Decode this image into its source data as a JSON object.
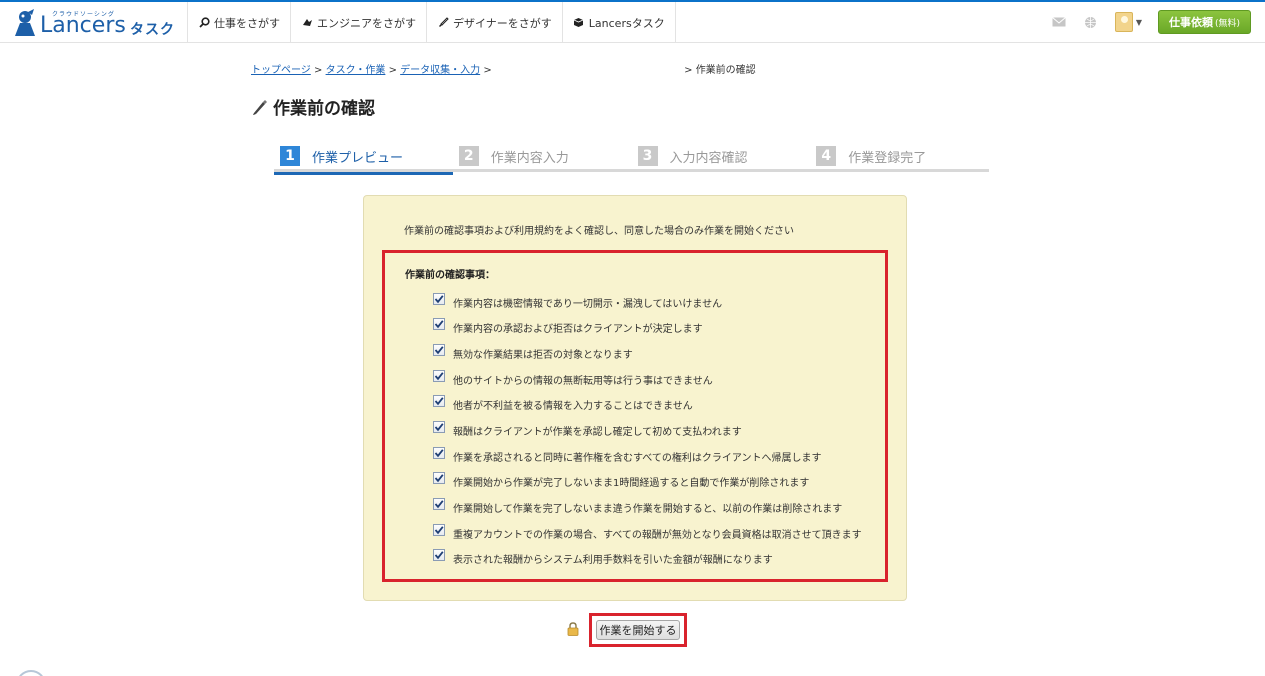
{
  "header": {
    "logo_tagline": "クラウドソーシング",
    "logo_word": "Lancers",
    "logo_suffix": "タスク",
    "nav": [
      {
        "label": "仕事をさがす",
        "icon": "search-icon"
      },
      {
        "label": "エンジニアをさがす",
        "icon": "engineer-icon"
      },
      {
        "label": "デザイナーをさがす",
        "icon": "brush-icon"
      },
      {
        "label": "Lancersタスク",
        "icon": "tasks-icon"
      }
    ],
    "order_button": "仕事依頼",
    "order_button_note": "(無料)"
  },
  "breadcrumb": {
    "items": [
      "トップページ",
      "タスク・作業",
      "データ収集・入力"
    ],
    "current": "作業前の確認",
    "separator": ">"
  },
  "page_title": "作業前の確認",
  "steps": [
    {
      "num": "1",
      "label": "作業プレビュー",
      "active": true
    },
    {
      "num": "2",
      "label": "作業内容入力",
      "active": false
    },
    {
      "num": "3",
      "label": "入力内容確認",
      "active": false
    },
    {
      "num": "4",
      "label": "作業登録完了",
      "active": false
    }
  ],
  "confirm": {
    "intro": "作業前の確認事項および利用規約をよく確認し、同意した場合のみ作業を開始ください",
    "title": "作業前の確認事項：",
    "items": [
      "作業内容は機密情報であり一切開示・漏洩してはいけません",
      "作業内容の承認および拒否はクライアントが決定します",
      "無効な作業結果は拒否の対象となります",
      "他のサイトからの情報の無断転用等は行う事はできません",
      "他者が不利益を被る情報を入力することはできません",
      "報酬はクライアントが作業を承認し確定して初めて支払われます",
      "作業を承認されると同時に著作権を含むすべての権利はクライアントへ帰属します",
      "作業開始から作業が完了しないまま1時間経過すると自動で作業が削除されます",
      "作業開始して作業を完了しないまま違う作業を開始すると、以前の作業は削除されます",
      "重複アカウントでの作業の場合、すべての報酬が無効となり会員資格は取消させて頂きます",
      "表示された報酬からシステム利用手数料を引いた金額が報酬になります"
    ]
  },
  "start_button": "作業を開始する",
  "colors": {
    "brand_blue": "#1d5fa8",
    "highlight_red": "#d9232d",
    "confirm_bg": "#f8f3cf",
    "order_green": "#6aa827"
  }
}
